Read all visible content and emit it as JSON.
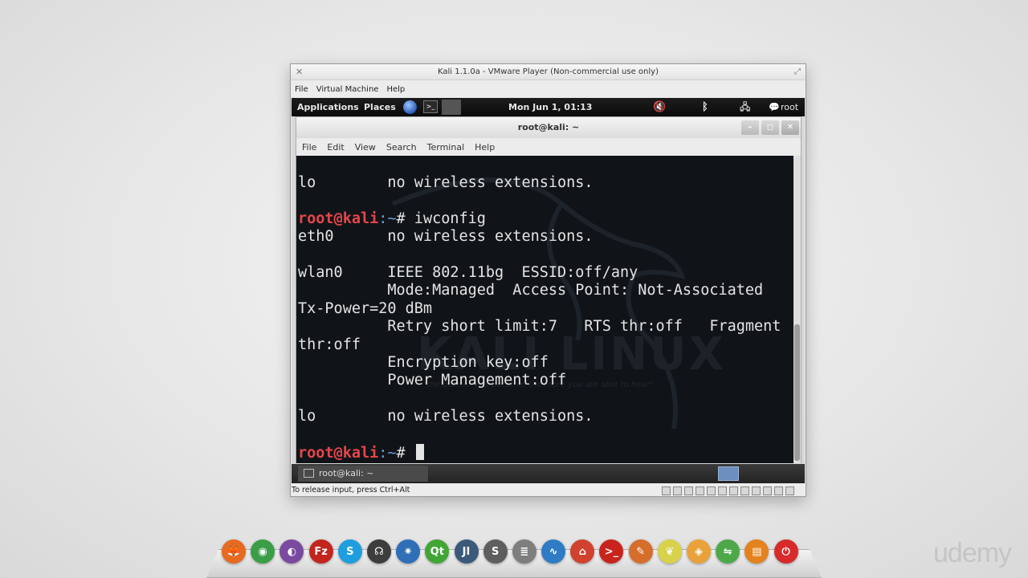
{
  "vmware": {
    "title": "Kali 1.1.0a - VMware Player (Non-commercial use only)",
    "menu": [
      "File",
      "Virtual Machine",
      "Help"
    ],
    "status_text": "To release input, press Ctrl+Alt"
  },
  "kali_panel": {
    "applications": "Applications",
    "places": "Places",
    "clock": "Mon Jun  1, 01:13",
    "user": "root"
  },
  "terminal": {
    "title": "root@kali: ~",
    "menu": [
      "File",
      "Edit",
      "View",
      "Search",
      "Terminal",
      "Help"
    ],
    "lines": [
      {
        "text": "lo        no wireless extensions."
      },
      {
        "text": ""
      },
      {
        "prompt_user": "root@kali",
        "prompt_path": ":~",
        "text": "# iwconfig"
      },
      {
        "text": "eth0      no wireless extensions."
      },
      {
        "text": ""
      },
      {
        "text": "wlan0     IEEE 802.11bg  ESSID:off/any"
      },
      {
        "text": "          Mode:Managed  Access Point: Not-Associated"
      },
      {
        "text": "Tx-Power=20 dBm"
      },
      {
        "text": "          Retry short limit:7   RTS thr:off   Fragment"
      },
      {
        "text": "thr:off"
      },
      {
        "text": "          Encryption key:off"
      },
      {
        "text": "          Power Management:off"
      },
      {
        "text": ""
      },
      {
        "text": "lo        no wireless extensions."
      },
      {
        "text": ""
      },
      {
        "prompt_user": "root@kali",
        "prompt_path": ":~",
        "text": "# ",
        "cursor": true
      }
    ],
    "watermark": "KALI LINUX",
    "watermark_tagline": "\"the quieter you become, the more you are able to hear\""
  },
  "guest_taskbar": {
    "task_label": "root@kali: ~"
  },
  "dock": {
    "icons": [
      {
        "name": "firefox-icon",
        "glyph": "🦊",
        "color": "#e66a1f"
      },
      {
        "name": "chrome-icon",
        "glyph": "◉",
        "color": "#3a9e47"
      },
      {
        "name": "tor-icon",
        "glyph": "◐",
        "color": "#7a4aa0"
      },
      {
        "name": "filezilla-icon",
        "glyph": "Fz",
        "color": "#c3261f"
      },
      {
        "name": "skype-icon",
        "glyph": "S",
        "color": "#1e9ede"
      },
      {
        "name": "headphones-icon",
        "glyph": "☊",
        "color": "#3d3d3d"
      },
      {
        "name": "network-icon",
        "glyph": "✷",
        "color": "#2e6fb8"
      },
      {
        "name": "qt-icon",
        "glyph": "Qt",
        "color": "#41a635"
      },
      {
        "name": "jetbrains-icon",
        "glyph": "JI",
        "color": "#3b5a7a"
      },
      {
        "name": "sublime-icon",
        "glyph": "S",
        "color": "#5e5e5e"
      },
      {
        "name": "document-icon",
        "glyph": "≣",
        "color": "#7e7e7e"
      },
      {
        "name": "wave-icon",
        "glyph": "∿",
        "color": "#2f7cc4"
      },
      {
        "name": "genie-icon",
        "glyph": "⌂",
        "color": "#d0422e"
      },
      {
        "name": "terminal-red-icon",
        "glyph": ">_",
        "color": "#c8241d"
      },
      {
        "name": "tool-icon",
        "glyph": "✎",
        "color": "#d66e2b"
      },
      {
        "name": "leaf-icon",
        "glyph": "❦",
        "color": "#d8d24a"
      },
      {
        "name": "photo-icon",
        "glyph": "◈",
        "color": "#e9a23b"
      },
      {
        "name": "toggle-icon",
        "glyph": "⇋",
        "color": "#4ea84a"
      },
      {
        "name": "drawer-icon",
        "glyph": "▤",
        "color": "#e4821d"
      },
      {
        "name": "power-icon",
        "glyph": "⏻",
        "color": "#d72b2b"
      }
    ]
  },
  "branding": {
    "udemy": "udemy"
  }
}
